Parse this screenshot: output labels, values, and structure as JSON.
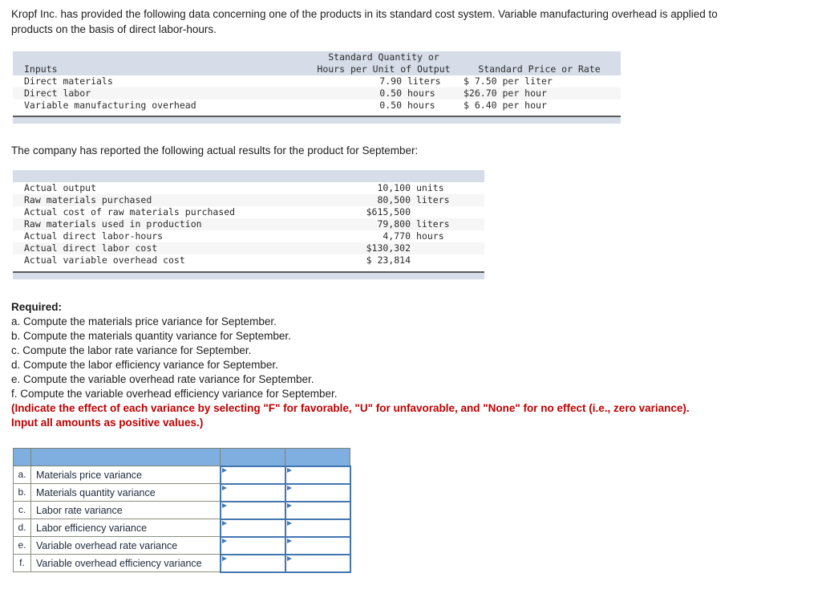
{
  "intro": {
    "paragraph": "Kropf Inc. has provided the following data concerning one of the products in its standard cost system. Variable manufacturing overhead is applied to products on the basis of direct labor-hours.",
    "actual_results_lead_in": "The company has reported the following actual results for the product for September:"
  },
  "standard_cost_table": {
    "header": {
      "inputs": "Inputs",
      "quantity_line1": "Standard Quantity or",
      "quantity_line2": "Hours per Unit of Output",
      "price_or_rate": "Standard Price or Rate"
    },
    "rows": [
      {
        "input": "Direct materials",
        "qty": "7.90",
        "qty_unit": "liters",
        "rate": "$ 7.50",
        "rate_unit": "per liter"
      },
      {
        "input": "Direct labor",
        "qty": "0.50",
        "qty_unit": "hours",
        "rate": "$26.70",
        "rate_unit": "per hour"
      },
      {
        "input": "Variable manufacturing overhead",
        "qty": "0.50",
        "qty_unit": "hours",
        "rate": "$ 6.40",
        "rate_unit": "per hour"
      }
    ]
  },
  "actual_results_table": {
    "rows": [
      {
        "label": "Actual output",
        "value": "10,100",
        "unit": "units"
      },
      {
        "label": "Raw materials purchased",
        "value": "80,500",
        "unit": "liters"
      },
      {
        "label": "Actual cost of raw materials purchased",
        "value": "$615,500",
        "unit": ""
      },
      {
        "label": "Raw materials used in production",
        "value": "79,800",
        "unit": "liters"
      },
      {
        "label": "Actual direct labor-hours",
        "value": "4,770",
        "unit": "hours"
      },
      {
        "label": "Actual direct labor cost",
        "value": "$130,302",
        "unit": ""
      },
      {
        "label": "Actual variable overhead cost",
        "value": "$ 23,814",
        "unit": ""
      }
    ]
  },
  "required": {
    "heading": "Required:",
    "items": [
      "a. Compute the materials price variance for September.",
      "b. Compute the materials quantity variance for September.",
      "c. Compute the labor rate variance for September.",
      "d. Compute the labor efficiency variance for September.",
      "e. Compute the variable overhead rate variance for September.",
      "f. Compute the variable overhead efficiency variance for September."
    ],
    "note": "(Indicate the effect of each variance by selecting \"F\" for favorable, \"U\" for unfavorable, and \"None\" for no effect (i.e., zero variance). Input all amounts as positive values.)"
  },
  "answer_table": {
    "rows": [
      {
        "letter": "a.",
        "description": "Materials price variance",
        "amount": "",
        "effect": ""
      },
      {
        "letter": "b.",
        "description": "Materials quantity variance",
        "amount": "",
        "effect": ""
      },
      {
        "letter": "c.",
        "description": "Labor rate variance",
        "amount": "",
        "effect": ""
      },
      {
        "letter": "d.",
        "description": "Labor efficiency variance",
        "amount": "",
        "effect": ""
      },
      {
        "letter": "e.",
        "description": "Variable overhead rate variance",
        "amount": "",
        "effect": ""
      },
      {
        "letter": "f.",
        "description": "Variable overhead efficiency variance",
        "amount": "",
        "effect": ""
      }
    ]
  },
  "colors": {
    "table_header_band": "#d6dce8",
    "answer_header_blue": "#7fafe0",
    "input_border_blue": "#4277b0",
    "note_red": "#c00000"
  }
}
